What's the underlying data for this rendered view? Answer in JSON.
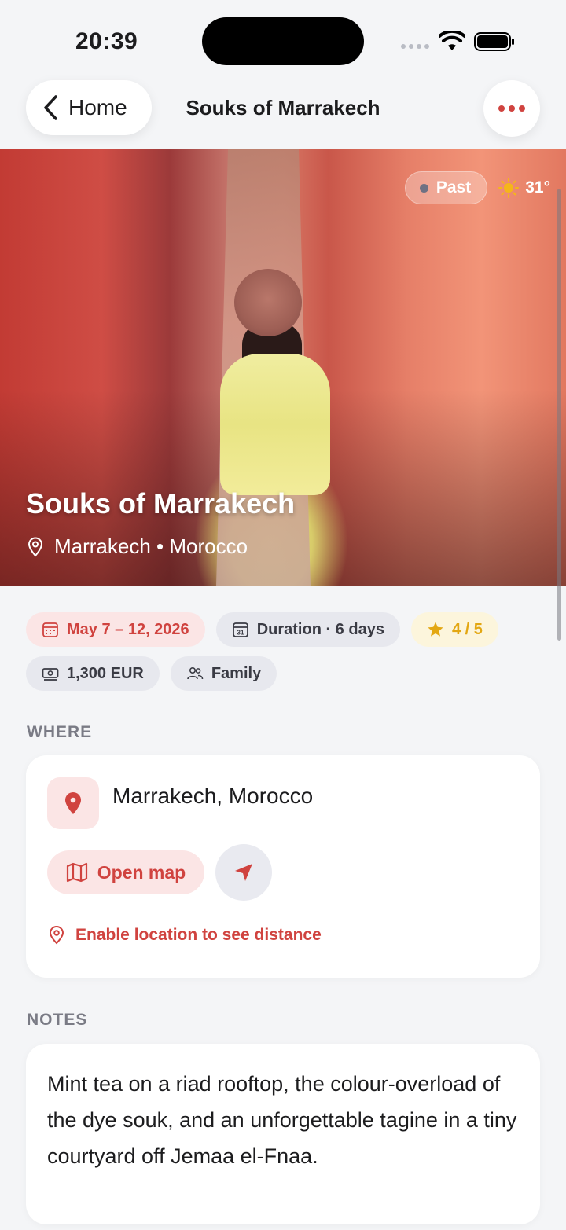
{
  "status_bar": {
    "time": "20:39"
  },
  "nav": {
    "back_label": "Home",
    "title": "Souks of Marrakech"
  },
  "hero": {
    "status_badge": "Past",
    "temperature": "31°",
    "title": "Souks of Marrakech",
    "location": "Marrakech • Morocco"
  },
  "chips": {
    "dates": "May 7 – 12, 2026",
    "duration": "Duration · 6 days",
    "rating": "4 / 5",
    "budget": "1,300 EUR",
    "companions": "Family"
  },
  "where": {
    "section_label": "WHERE",
    "place": "Marrakech, Morocco",
    "open_map_label": "Open map",
    "enable_location_label": "Enable location to see distance"
  },
  "notes": {
    "section_label": "NOTES",
    "text": "Mint tea on a riad rooftop, the colour-overload of the dye souk, and an unforgettable tagine in a tiny courtyard off Jemaa el-Fnaa."
  },
  "colors": {
    "accent": "#d0433f",
    "accent_soft": "#fbe5e5",
    "rating": "#e3a712",
    "background": "#f4f5f7"
  },
  "icons": {
    "back": "chevron-left-icon",
    "more": "more-dots-icon",
    "weather": "sun-icon",
    "location": "location-pin-icon",
    "calendar": "calendar-icon",
    "duration": "calendar-31-icon",
    "rating": "star-icon",
    "budget": "banknote-icon",
    "companions": "people-icon",
    "map": "map-icon",
    "navigate": "navigation-arrow-icon"
  }
}
